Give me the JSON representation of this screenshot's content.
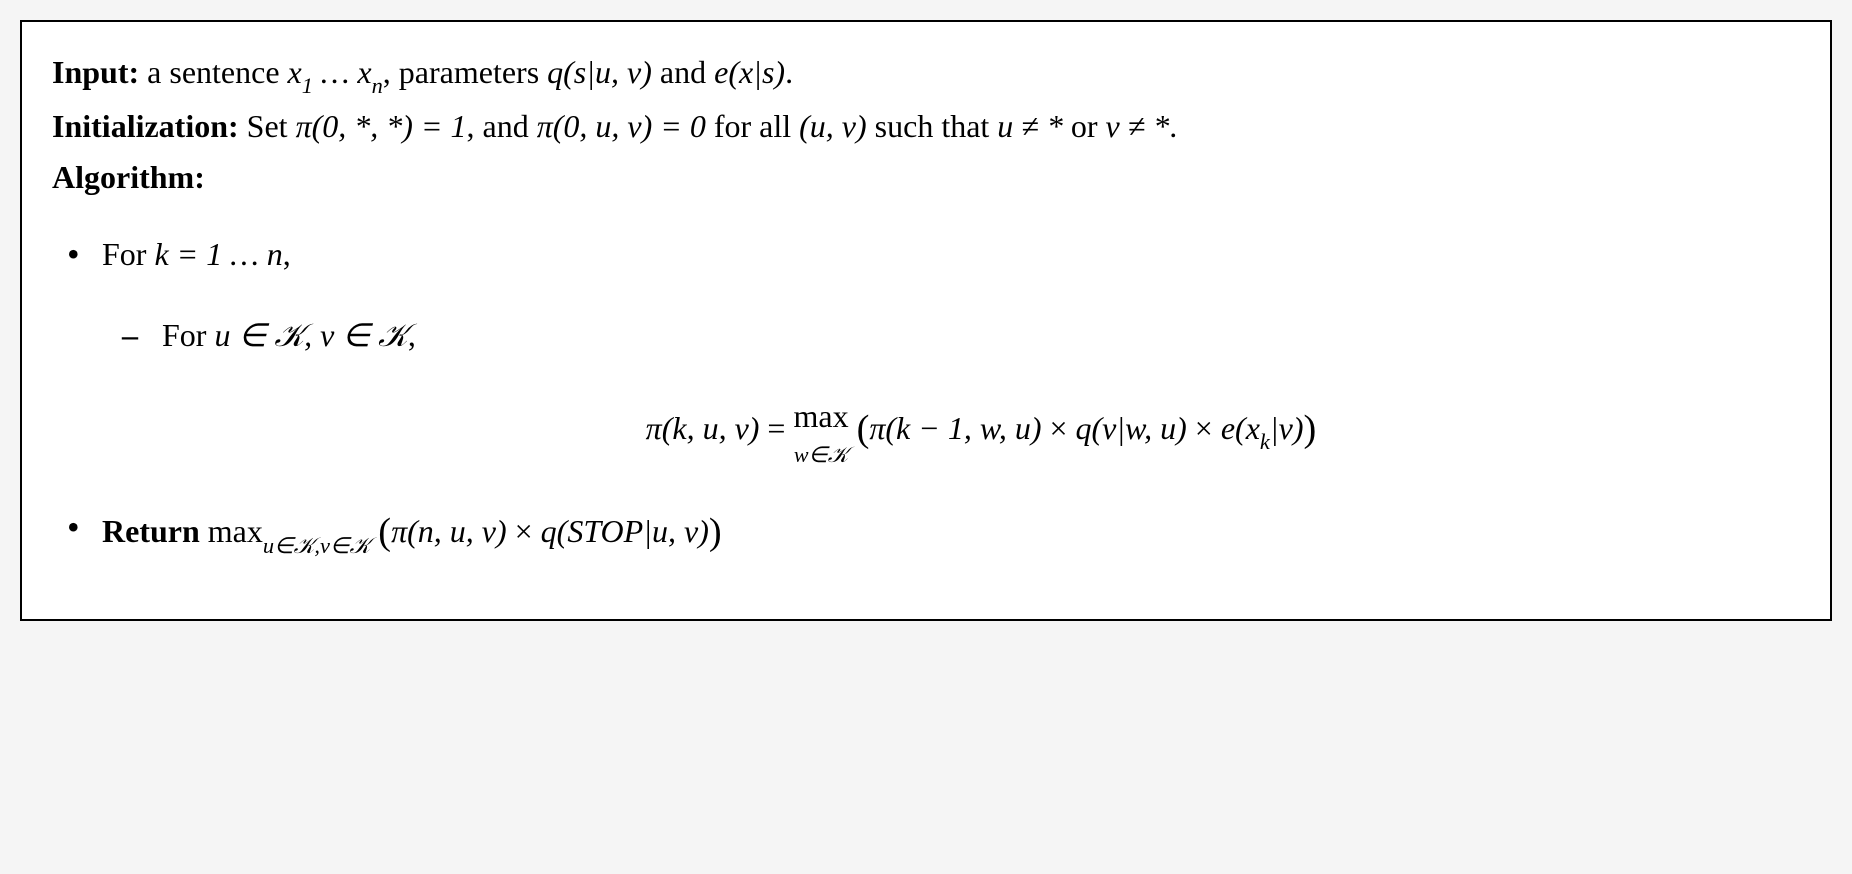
{
  "input": {
    "label": "Input:",
    "text_before": " a sentence ",
    "sentence": "x₁ … xₙ",
    "text_mid": ", parameters ",
    "param_q": "q(s|u, v)",
    "and": " and ",
    "param_e": "e(x|s)",
    "end": "."
  },
  "init": {
    "label": "Initialization:",
    "text_set": " Set ",
    "pi1": "π(0, *, *) = 1",
    "and": ", and ",
    "pi2": "π(0, u, v) = 0",
    "forall": " for all ",
    "uv": "(u, v)",
    "suchthat": " such that ",
    "cond1": "u ≠ *",
    "or": " or ",
    "cond2": "v ≠ *",
    "end": "."
  },
  "algo": {
    "label": "Algorithm:"
  },
  "loop1": {
    "for": "For ",
    "cond": "k = 1 … n",
    "comma": ","
  },
  "loop2": {
    "for": "For ",
    "cond": "u ∈ 𝒦, v ∈ 𝒦",
    "comma": ","
  },
  "eq": {
    "lhs": "π(k, u, v)",
    "equals": " = ",
    "max": "max",
    "maxsub": "w∈𝒦",
    "lparen": "(",
    "t1": "π(k − 1, w, u)",
    "times": " × ",
    "t2": "q(v|w, u)",
    "t3": "e(xₖ|v)",
    "rparen": ")"
  },
  "ret": {
    "label": "Return ",
    "max": "max",
    "maxsub": "u∈𝒦,v∈𝒦",
    "lparen": " (",
    "t1": "π(n, u, v)",
    "times": " × ",
    "t2": "q(STOP|u, v)",
    "rparen": ")"
  }
}
